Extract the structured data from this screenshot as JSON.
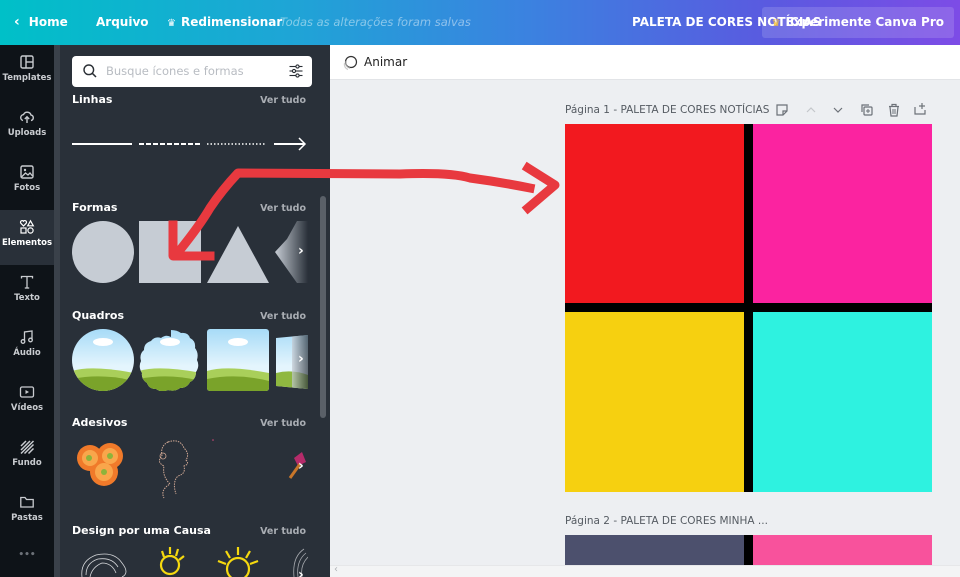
{
  "topbar": {
    "home_label": "Home",
    "file_label": "Arquivo",
    "resize_label": "Redimensionar",
    "save_status": "Todas as alterações foram salvas",
    "document_title": "PALETA DE CORES NOTÍCIAS",
    "pro_button_label": "Experimente Canva Pro"
  },
  "nav": {
    "items": [
      {
        "label": "Templates",
        "icon": "templates-icon"
      },
      {
        "label": "Uploads",
        "icon": "upload-cloud-icon"
      },
      {
        "label": "Fotos",
        "icon": "photo-icon"
      },
      {
        "label": "Elementos",
        "icon": "elements-icon",
        "active": true
      },
      {
        "label": "Texto",
        "icon": "text-icon"
      },
      {
        "label": "Áudio",
        "icon": "music-note-icon"
      },
      {
        "label": "Vídeos",
        "icon": "video-icon"
      },
      {
        "label": "Fundo",
        "icon": "background-pattern-icon"
      },
      {
        "label": "Pastas",
        "icon": "folder-icon"
      }
    ],
    "more_label": "•••"
  },
  "panel": {
    "search_placeholder": "Busque ícones e formas",
    "see_all": "Ver tudo",
    "sections": [
      {
        "title": "Linhas",
        "items": [
          "solid-line",
          "dashed-line",
          "dotted-line",
          "arrow-line"
        ]
      },
      {
        "title": "Formas",
        "items": [
          "circle",
          "square",
          "triangle",
          "hexagon"
        ]
      },
      {
        "title": "Quadros",
        "items": [
          "circle-frame",
          "scalloped-frame",
          "square-frame",
          "tilted-frame"
        ]
      },
      {
        "title": "Adesivos",
        "items": [
          "orange-flowers",
          "face-line-art",
          "blank",
          "paint-brush"
        ]
      },
      {
        "title": "Design por uma Causa",
        "items": [
          "hair-sketch",
          "smiley-sun",
          "sun-face",
          "woman-sketch"
        ]
      }
    ]
  },
  "canvas": {
    "animate_label": "Animar",
    "pages": [
      {
        "label": "Página 1 - PALETA DE CORES NOTÍCIAS",
        "colors": [
          "#f2191f",
          "#fb23a0",
          "#f6d010",
          "#2ef2e0"
        ]
      },
      {
        "label": "Página 2 - PALETA DE CORES MINHA   ...",
        "colors": [
          "#4c506d",
          "#f8529c"
        ]
      }
    ],
    "divider_color": "#000000"
  },
  "annotation": {
    "color": "#e8393f",
    "description": "double-headed red arrow from Formas square to Page 1 design"
  }
}
